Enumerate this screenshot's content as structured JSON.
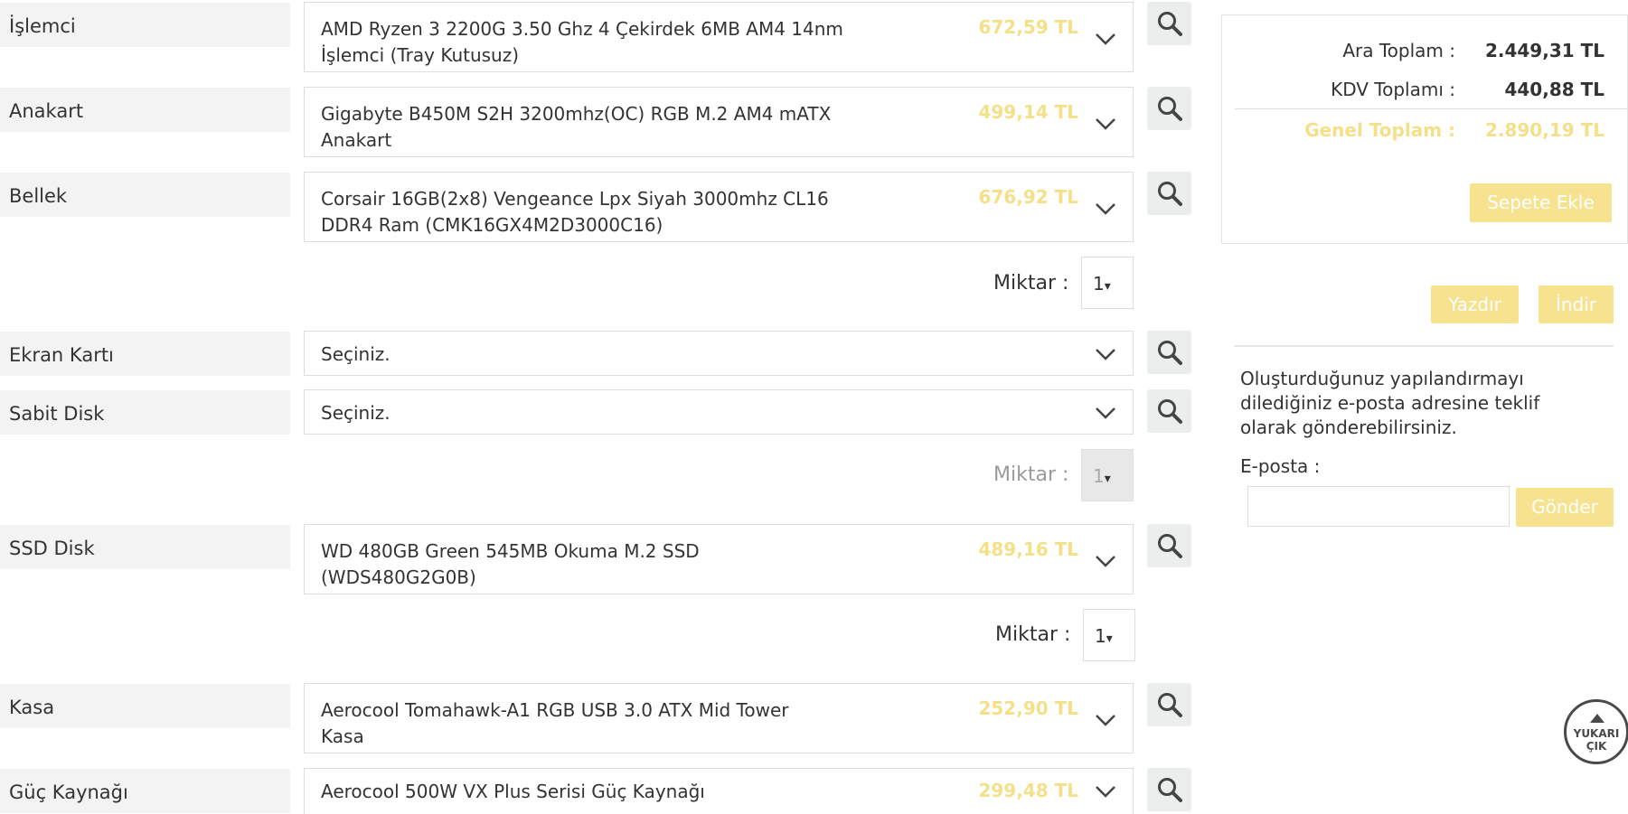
{
  "components": [
    {
      "label": "İşlemci",
      "value_line1": "AMD Ryzen 3 2200G 3.50 Ghz 4 Çekirdek 6MB AM4 14nm",
      "value_line2": "İşlemci (Tray Kutusuz)",
      "price": "672,59 TL"
    },
    {
      "label": "Anakart",
      "value_line1": "Gigabyte B450M S2H 3200mhz(OC) RGB M.2 AM4 mATX",
      "value_line2": "Anakart",
      "price": "499,14 TL"
    },
    {
      "label": "Bellek",
      "value_line1": "Corsair 16GB(2x8) Vengeance Lpx Siyah 3000mhz CL16",
      "value_line2": "DDR4 Ram (CMK16GX4M2D3000C16)",
      "price": "676,92 TL"
    },
    {
      "label": "Ekran Kartı",
      "value_line1": "Seçiniz.",
      "value_line2": "",
      "price": ""
    },
    {
      "label": "Sabit Disk",
      "value_line1": "Seçiniz.",
      "value_line2": "",
      "price": ""
    },
    {
      "label": "SSD Disk",
      "value_line1": "WD 480GB Green 545MB Okuma M.2 SSD",
      "value_line2": "(WDS480G2G0B)",
      "price": "489,16 TL"
    },
    {
      "label": "Kasa",
      "value_line1": "Aerocool Tomahawk-A1 RGB USB 3.0 ATX Mid Tower",
      "value_line2": "Kasa",
      "price": "252,90 TL"
    },
    {
      "label": "Güç Kaynağı",
      "value_line1": "Aerocool 500W VX Plus Serisi Güç Kaynağı",
      "value_line2": "",
      "price": "299,48 TL"
    }
  ],
  "quantity": {
    "label": "Miktar :",
    "bellek_value": "1",
    "sabit_disk_value": "1",
    "ssd_value": "1",
    "caret": "▾"
  },
  "summary": {
    "subtotal_label": "Ara Toplam :",
    "subtotal_value": "2.449,31 TL",
    "vat_label": "KDV Toplamı :",
    "vat_value": "440,88 TL",
    "grand_label": "Genel Toplam :",
    "grand_value": "2.890,19 TL",
    "add_to_cart": "Sepete Ekle"
  },
  "actions": {
    "print": "Yazdır",
    "download": "İndir"
  },
  "email": {
    "info": "Oluşturduğunuz yapılandırmayı dilediğiniz e-posta adresine teklif olarak gönderebilirsiniz.",
    "label": "E-posta :",
    "placeholder": "",
    "send": "Gönder"
  },
  "scroll_top": {
    "line1": "YUKARI",
    "line2": "ÇIK"
  },
  "colors": {
    "accent": "#f7e28f",
    "price": "#f5e08a",
    "label_bg": "#f3f3f3",
    "search_bg": "#eceded"
  },
  "icons": {
    "search": "search-icon",
    "chevron": "chevron-down-icon",
    "up": "arrow-up-icon"
  }
}
